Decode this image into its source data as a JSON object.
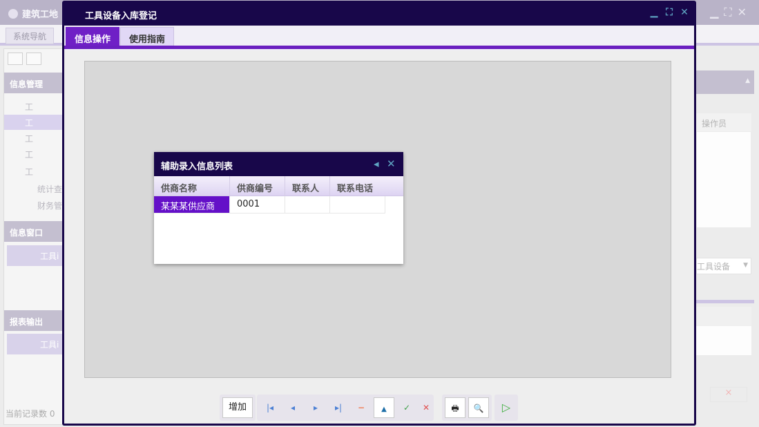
{
  "background_app": {
    "title": "建筑工地",
    "tab": "系统导航",
    "section_info_mgmt": "信息管理",
    "tree_items": [
      "工",
      "工",
      "工",
      "工",
      "工"
    ],
    "tree_folder_1": "统计查",
    "tree_folder_2": "财务管",
    "section_info_window": "信息窗口",
    "sub_head_1": "工具i",
    "section_report": "报表输出",
    "sub_head_2": "工具i",
    "status": "当前记录数 0",
    "right_col_header": "操作员",
    "right_dropdown_value": "工具设备",
    "right_delete_icon": "×"
  },
  "window": {
    "title": "工具设备入库登记",
    "controls": {
      "minimize": "▁",
      "maximize": "⛶",
      "close": "✕"
    }
  },
  "tabs": [
    {
      "label": "信息操作",
      "active": true
    },
    {
      "label": "使用指南",
      "active": false
    }
  ],
  "popup": {
    "title": "辅助录入信息列表",
    "controls": {
      "collapse": "◂",
      "close": "✕"
    },
    "columns": [
      "供商名称",
      "供商编号",
      "联系人",
      "联系电话"
    ],
    "rows": [
      {
        "name": "某某某供应商",
        "code": "0001",
        "contact": "",
        "phone": ""
      }
    ]
  },
  "toolbar": {
    "add_label": "增加",
    "icons": {
      "first": "|◂",
      "prev": "◂",
      "next": "▸",
      "last": "▸|",
      "delete": "−",
      "up": "▲",
      "confirm": "✓",
      "cancel": "✕",
      "print": "🖶",
      "preview": "🔍",
      "run": "▷"
    },
    "colors": {
      "nav": "#4a7fd4",
      "delete": "#f07a50",
      "up": "#1e6fa8",
      "confirm": "#3fa14a",
      "cancel": "#e05050",
      "run": "#3fae3f"
    }
  }
}
